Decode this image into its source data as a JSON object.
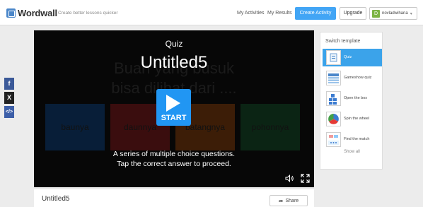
{
  "header": {
    "logo_text": "Wordwall",
    "tagline": "Create better lessons quicker",
    "my_activities": "My Activities",
    "my_results": "My Results",
    "create_activity": "Create Activity",
    "upgrade": "Upgrade",
    "user_initial": "D",
    "user_name": "novladwihana",
    "user_chevron": "▾"
  },
  "social": {
    "facebook": "f",
    "x": "X",
    "embed": "</>"
  },
  "player": {
    "quiz_label": "Quiz",
    "title": "Untitled5",
    "start": "START",
    "description_line1": "A series of multiple choice questions.",
    "description_line2": "Tap the correct answer to proceed.",
    "bg_question_line1": "Buah yang busuk",
    "bg_question_line2": "bisa dilihat dari ....",
    "bg_answers": [
      {
        "text": "baunya",
        "color": "#0d2f56"
      },
      {
        "text": "daunnya",
        "color": "#591516"
      },
      {
        "text": "batangnya",
        "color": "#5c2d0c"
      },
      {
        "text": "pohonnya",
        "color": "#123820"
      }
    ]
  },
  "switch_template": {
    "title": "Switch template",
    "items": [
      {
        "label": "Quiz",
        "icon": "quiz-icon",
        "active": true
      },
      {
        "label": "Gameshow quiz",
        "icon": "gameshow-quiz-icon",
        "active": false
      },
      {
        "label": "Open the box",
        "icon": "open-the-box-icon",
        "active": false
      },
      {
        "label": "Spin the wheel",
        "icon": "spin-the-wheel-icon",
        "active": false
      },
      {
        "label": "Find the match",
        "icon": "find-the-match-icon",
        "active": false
      }
    ],
    "show_all": "Show all"
  },
  "bottom": {
    "title": "Untitled5",
    "share": "Share"
  },
  "colors": {
    "accent": "#42a5f5",
    "start_button": "#2196f3",
    "active_template": "#3ba3ea"
  }
}
